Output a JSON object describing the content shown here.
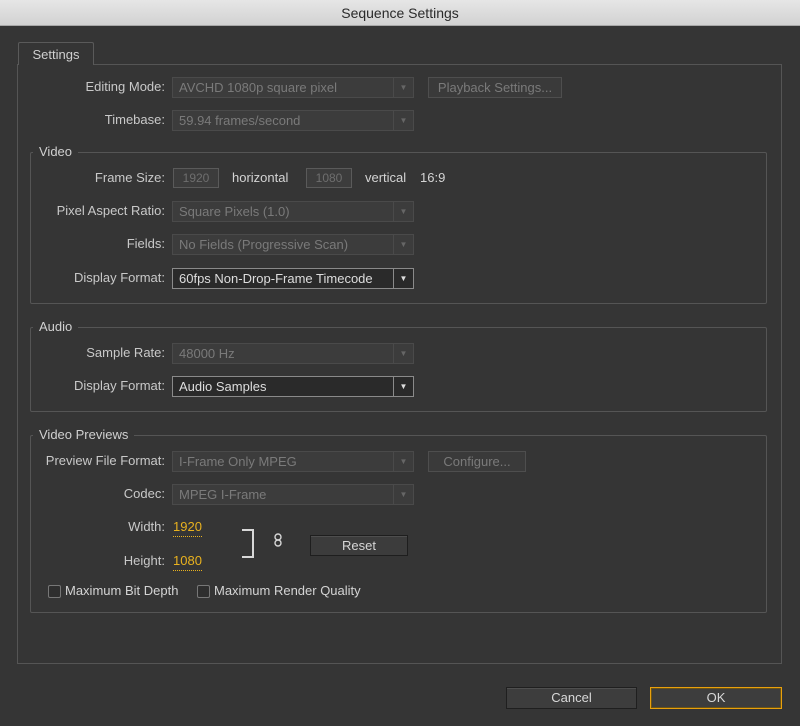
{
  "window": {
    "title": "Sequence Settings"
  },
  "tabs": [
    {
      "label": "Settings"
    }
  ],
  "general": {
    "editing_mode": {
      "label": "Editing Mode:",
      "value": "AVCHD 1080p square pixel"
    },
    "playback_settings_label": "Playback Settings...",
    "timebase": {
      "label": "Timebase:",
      "value": "59.94 frames/second"
    }
  },
  "video": {
    "title": "Video",
    "frame_size": {
      "label": "Frame Size:",
      "horizontal_value": "1920",
      "horizontal_label": "horizontal",
      "vertical_value": "1080",
      "vertical_label": "vertical",
      "aspect": "16:9"
    },
    "pixel_aspect_ratio": {
      "label": "Pixel Aspect Ratio:",
      "value": "Square Pixels (1.0)"
    },
    "fields": {
      "label": "Fields:",
      "value": "No Fields (Progressive Scan)"
    },
    "display_format": {
      "label": "Display Format:",
      "value": "60fps Non-Drop-Frame Timecode"
    }
  },
  "audio": {
    "title": "Audio",
    "sample_rate": {
      "label": "Sample Rate:",
      "value": "48000 Hz"
    },
    "display_format": {
      "label": "Display Format:",
      "value": "Audio Samples"
    }
  },
  "video_previews": {
    "title": "Video Previews",
    "preview_file_format": {
      "label": "Preview File Format:",
      "value": "I-Frame Only MPEG"
    },
    "configure_label": "Configure...",
    "codec": {
      "label": "Codec:",
      "value": "MPEG I-Frame"
    },
    "width": {
      "label": "Width:",
      "value": "1920"
    },
    "height": {
      "label": "Height:",
      "value": "1080"
    },
    "reset_label": "Reset",
    "max_bit_depth": {
      "label": "Maximum Bit Depth",
      "checked": false
    },
    "max_render_quality": {
      "label": "Maximum Render Quality",
      "checked": false
    }
  },
  "footer": {
    "cancel_label": "Cancel",
    "ok_label": "OK"
  },
  "colors": {
    "accent": "#e9b21f",
    "ok_border": "#e9a00c",
    "background": "#353535"
  },
  "icons": {
    "dropdown": "chevron-down-icon",
    "link": "chain-link-icon"
  }
}
